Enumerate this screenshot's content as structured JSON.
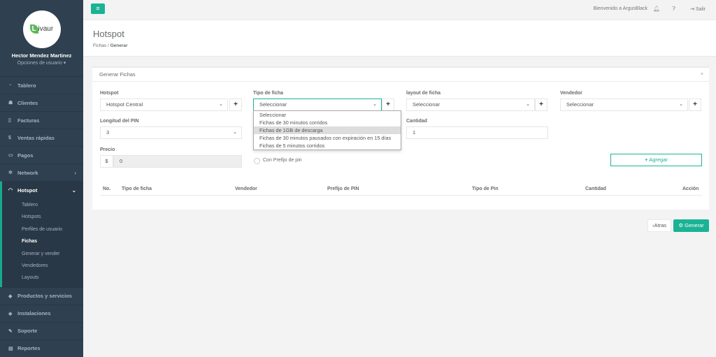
{
  "sidebar": {
    "logo_text": "ivaur",
    "logo_letter": "L",
    "user_name": "Hector Mendez Martinez",
    "user_options": "Opciones de usuario ▾",
    "items": [
      {
        "label": "Tablero",
        "icon": "dashboard-icon"
      },
      {
        "label": "Clientes",
        "icon": "users-icon"
      },
      {
        "label": "Facturas",
        "icon": "file-icon"
      },
      {
        "label": "Ventas rápidas",
        "icon": "dollar-icon"
      },
      {
        "label": "Pagos",
        "icon": "money-icon"
      },
      {
        "label": "Network",
        "icon": "network-icon"
      },
      {
        "label": "Hotspot",
        "icon": "wifi-icon"
      }
    ],
    "hotspot_sub": [
      "Tablero",
      "Hotspots",
      "Perfiles de usuario",
      "Fichas",
      "Generar y vender",
      "Vendedores",
      "Layouts"
    ],
    "bottom_items": [
      {
        "label": "Productos y servicios",
        "icon": "tag-icon"
      },
      {
        "label": "Instalaciones",
        "icon": "cube-icon"
      },
      {
        "label": "Soporte",
        "icon": "wrench-icon"
      },
      {
        "label": "Reportes",
        "icon": "book-icon"
      }
    ]
  },
  "topbar": {
    "welcome": "Bienvenido a ArgusBlack",
    "logout": "Salir"
  },
  "heading": {
    "title": "Hotspot",
    "crumb1": "Fichas",
    "sep": "/",
    "crumb2": "Generar"
  },
  "form": {
    "card_title": "Generar Fichas",
    "hotspot_label": "Hotspot",
    "hotspot_value": "Hotspot Central",
    "tipo_label": "Tipo de ficha",
    "tipo_value": "Seleccionar",
    "layout_label": "layout de ficha",
    "layout_value": "Seleccionar",
    "vendedor_label": "Vendedor",
    "vendedor_value": "Seleccionar",
    "longitud_label": "Longitud del PIN",
    "longitud_value": "3",
    "cantidad_label": "Cantidad",
    "cantidad_value": "1",
    "precio_label": "Precio",
    "precio_prefix": "$",
    "precio_value": "0",
    "prefijo_label": "Con Prefijo de pin",
    "agregar_label": "Agregar"
  },
  "dropdown_options": [
    "Seleccionar",
    "Fichas de 30 minutos corridos",
    "Fichas de 1GB de descarga",
    "Fichas de 30 minutos pausados con expiración en 15 días",
    "Fichas de 5 minutos corridos"
  ],
  "dropdown_highlight_index": 2,
  "table_headers": [
    "No.",
    "Tipo de ficha",
    "Vendedor",
    "Prefijo de PIN",
    "Tipo de Pin",
    "Cantidad",
    "Acción"
  ],
  "actions": {
    "back": "Atras",
    "generate": "Generar"
  },
  "colors": {
    "accent": "#1ab394",
    "sidebar_bg": "#2f4050"
  }
}
